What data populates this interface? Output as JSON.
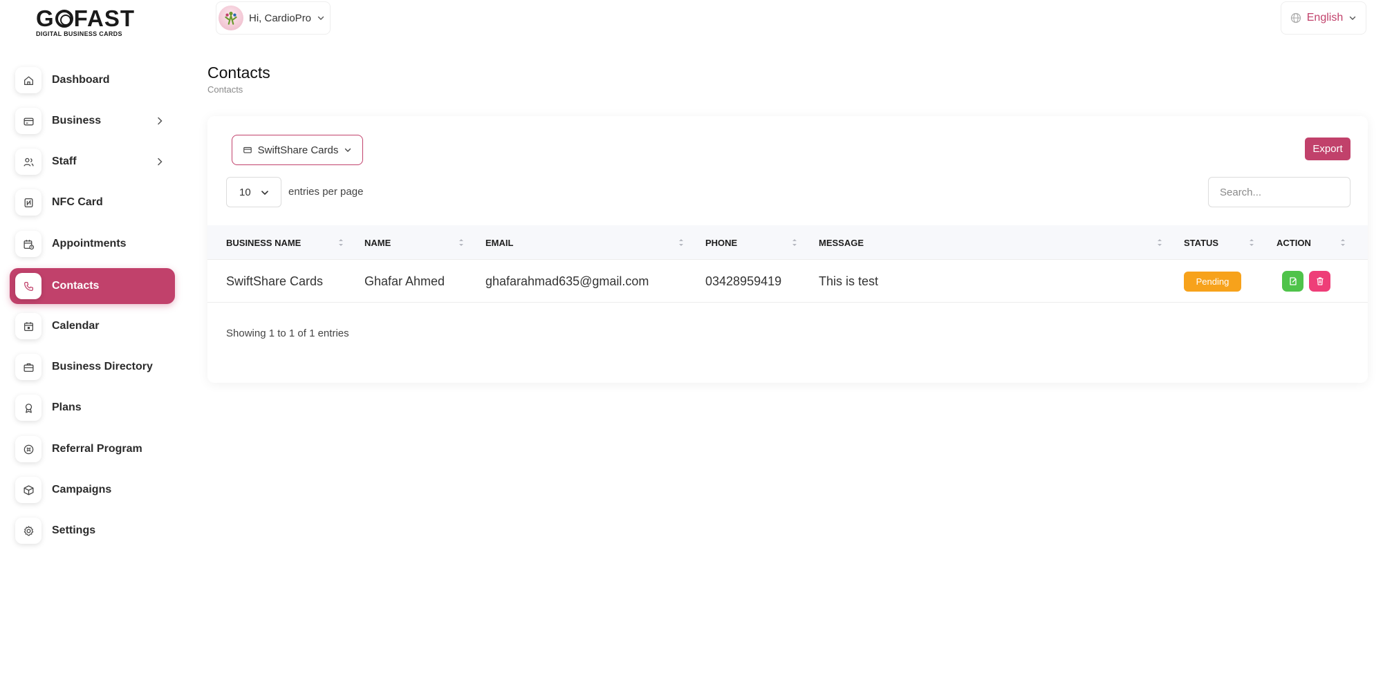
{
  "brand": {
    "logo_word": "GOFAST",
    "logo_tagline": "DIGITAL BUSINESS CARDS",
    "accent": "#c1416b"
  },
  "topbar": {
    "greeting": "Hi, CardioPro",
    "language": "English"
  },
  "sidebar": {
    "items": [
      {
        "label": "Dashboard",
        "icon": "home-icon"
      },
      {
        "label": "Business",
        "icon": "card-icon"
      },
      {
        "label": "Staff",
        "icon": "users-icon"
      },
      {
        "label": "NFC Card",
        "icon": "nfc-icon"
      },
      {
        "label": "Appointments",
        "icon": "calendar-clock-icon"
      },
      {
        "label": "Contacts",
        "icon": "phone-icon"
      },
      {
        "label": "Calendar",
        "icon": "calendar-icon"
      },
      {
        "label": "Business Directory",
        "icon": "briefcase-icon"
      },
      {
        "label": "Plans",
        "icon": "award-icon"
      },
      {
        "label": "Referral Program",
        "icon": "referral-icon"
      },
      {
        "label": "Campaigns",
        "icon": "box-icon"
      },
      {
        "label": "Settings",
        "icon": "gear-icon"
      }
    ],
    "active_index": 5
  },
  "page": {
    "title": "Contacts",
    "breadcrumb": "Contacts"
  },
  "toolbar": {
    "filter_label": "SwiftShare Cards",
    "export_label": "Export",
    "entries_value": "10",
    "entries_label": "entries per page",
    "search_placeholder": "Search..."
  },
  "table": {
    "columns": [
      "BUSINESS NAME",
      "NAME",
      "EMAIL",
      "PHONE",
      "MESSAGE",
      "STATUS",
      "ACTION"
    ],
    "rows": [
      {
        "business_name": "SwiftShare Cards",
        "name": "Ghafar Ahmed",
        "email": "ghafarahmad635@gmail.com",
        "phone": "03428959419",
        "message": "This is test",
        "status": "Pending"
      }
    ],
    "status_color": "#f7a21b",
    "edit_color": "#4fc34a",
    "delete_color": "#ee3e78"
  },
  "footer": {
    "showing": "Showing 1 to 1 of 1 entries"
  }
}
